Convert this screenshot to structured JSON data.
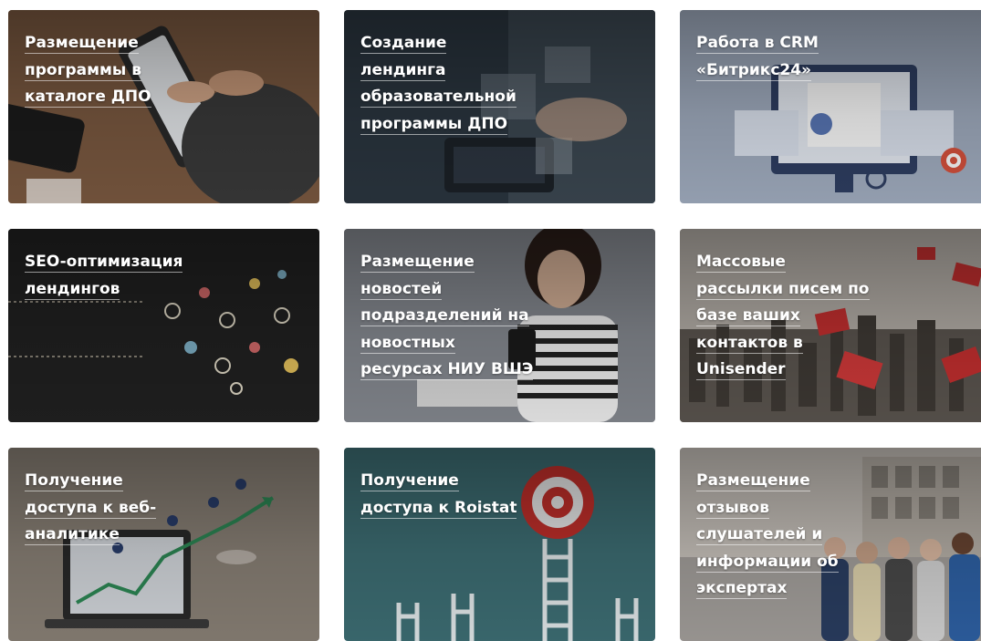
{
  "cards": [
    {
      "title": "Размещение программы в каталоге ДПО",
      "accent": "#7a5a44"
    },
    {
      "title": "Создание лендинга образовательной программы ДПО",
      "accent": "#2f3a44"
    },
    {
      "title": "Работа в CRM «Битрикс24»",
      "accent": "#9aa6bb"
    },
    {
      "title": "SEO-оптимизация лендингов",
      "accent": "#1d1d1d"
    },
    {
      "title": "Размещение новостей подразделений на новостных ресурсах НИУ ВШЭ",
      "accent": "#6b6f76"
    },
    {
      "title": "Массовые рассылки писем по базе ваших контактов в Unisender",
      "accent": "#5a5550"
    },
    {
      "title": "Получение доступа к веб-аналитике",
      "accent": "#8c8378"
    },
    {
      "title": "Получение доступа к Roistat",
      "accent": "#3e6e75"
    },
    {
      "title": "Размещение отзывов слушателей и информации об экспертах",
      "accent": "#9b8f86"
    }
  ]
}
